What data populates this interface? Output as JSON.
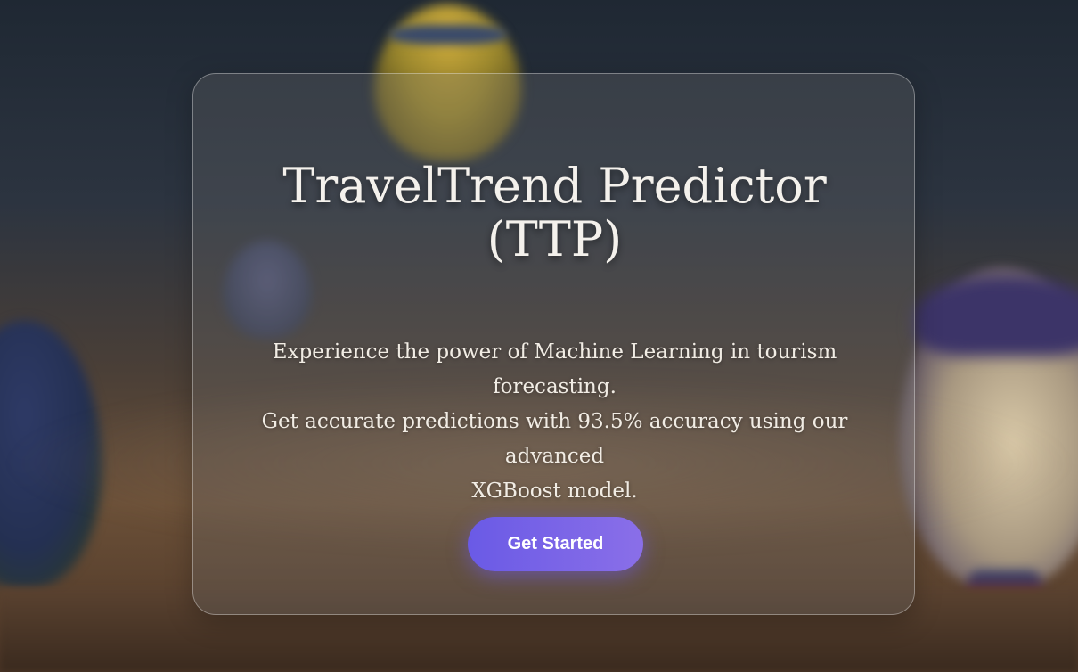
{
  "hero": {
    "title_line1": "TravelTrend Predictor",
    "title_line2": "(TTP)",
    "description_lines": [
      "Experience the power of Machine Learning in tourism",
      "forecasting.",
      "Get accurate predictions with 93.5% accuracy using our advanced",
      "XGBoost model."
    ],
    "cta_label": "Get Started"
  },
  "colors": {
    "accent": "#7363e8",
    "title_text": "#f4f1ec",
    "card_border": "#bfbfbf"
  },
  "background": {
    "image": "hot-air-balloons-photo"
  }
}
